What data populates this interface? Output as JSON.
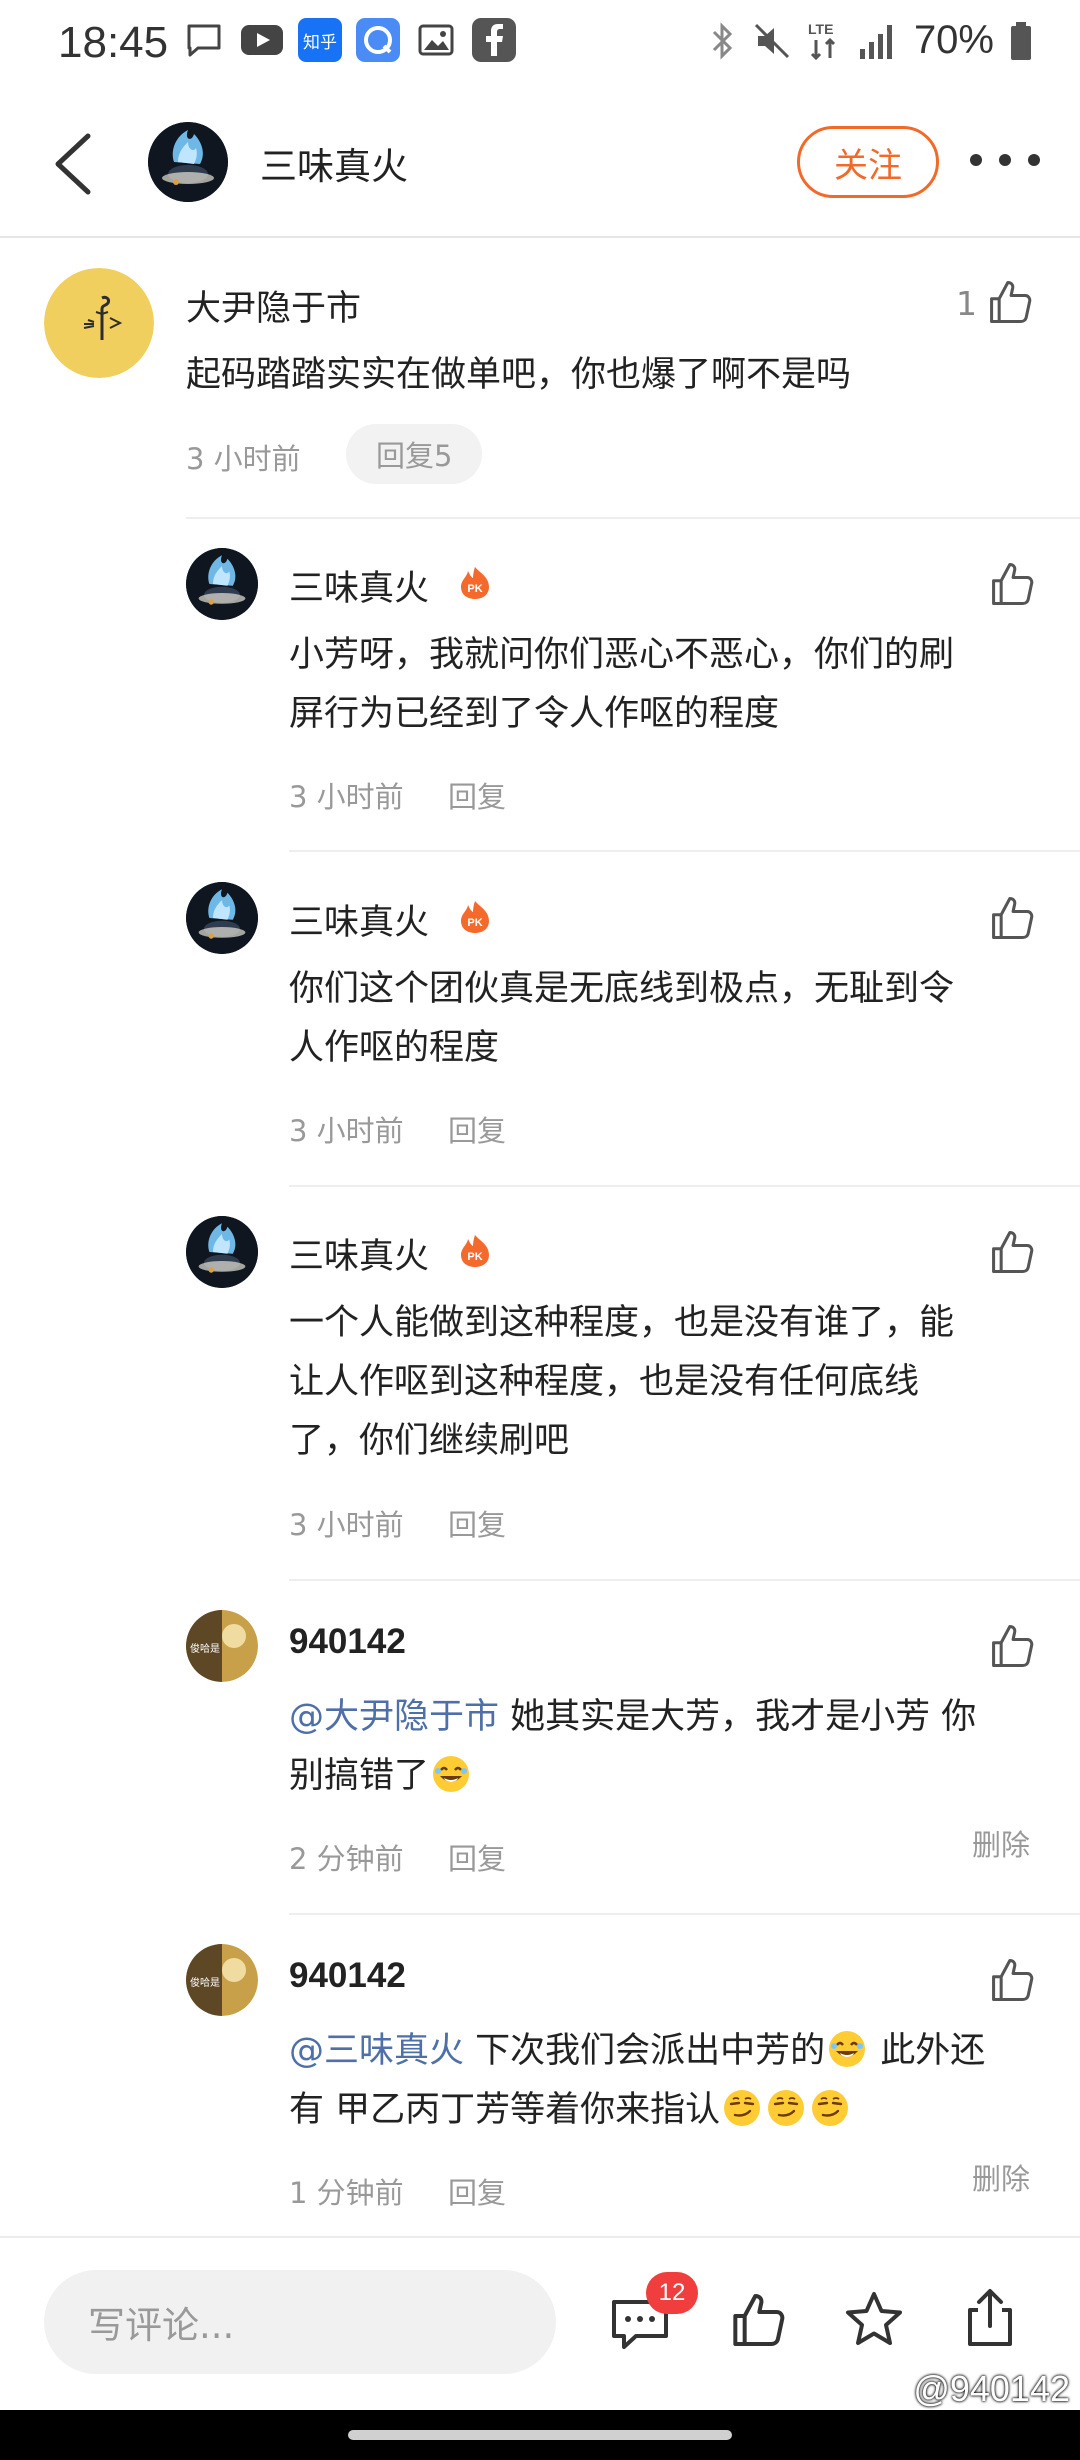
{
  "status_bar": {
    "time": "18:45",
    "network": "LTE",
    "battery": "70%",
    "app_badge_zhihu": "知乎"
  },
  "header": {
    "title": "三味真火",
    "follow_label": "关注"
  },
  "main_comment": {
    "author": "大尹隐于市",
    "text": "起码踏踏实实在做单吧，你也爆了啊不是吗",
    "time": "3 小时前",
    "reply_label": "回复5",
    "likes": "1"
  },
  "replies": [
    {
      "author": "三味真火",
      "badge": "PK",
      "lines": [
        "小芳呀，我就问你们恶心不恶心，你们的刷",
        "屏行为已经到了令人作呕的程度"
      ],
      "time": "3 小时前",
      "reply_label": "回复"
    },
    {
      "author": "三味真火",
      "badge": "PK",
      "lines": [
        "你们这个团伙真是无底线到极点，无耻到令",
        "人作呕的程度"
      ],
      "time": "3 小时前",
      "reply_label": "回复"
    },
    {
      "author": "三味真火",
      "badge": "PK",
      "lines": [
        "一个人能做到这种程度，也是没有谁了，能",
        "让人作呕到这种程度，也是没有任何底线",
        "了，你们继续刷吧"
      ],
      "time": "3 小时前",
      "reply_label": "回复"
    },
    {
      "author": "940142",
      "avatar_text": "俊哈是",
      "mention": "@大尹隐于市",
      "line1_rest": " 她其实是大芳，我才是小芳 你",
      "line2": "别搞错了",
      "time": "2 分钟前",
      "reply_label": "回复",
      "delete_label": "删除"
    },
    {
      "author": "940142",
      "avatar_text": "俊哈是",
      "mention": "@三味真火",
      "line1_rest": " 下次我们会派出中芳的",
      "line1_tail": " 此外还",
      "line2": "有 甲乙丙丁芳等着你来指认",
      "time": "1 分钟前",
      "reply_label": "回复",
      "delete_label": "删除"
    }
  ],
  "bottom_bar": {
    "input_placeholder": "写评论...",
    "comment_count": "12"
  },
  "watermark": "@940142",
  "colors": {
    "accent": "#f26a2a",
    "mention": "#4e6fa8",
    "muted": "#999999",
    "badge_red": "#f03e3e"
  }
}
